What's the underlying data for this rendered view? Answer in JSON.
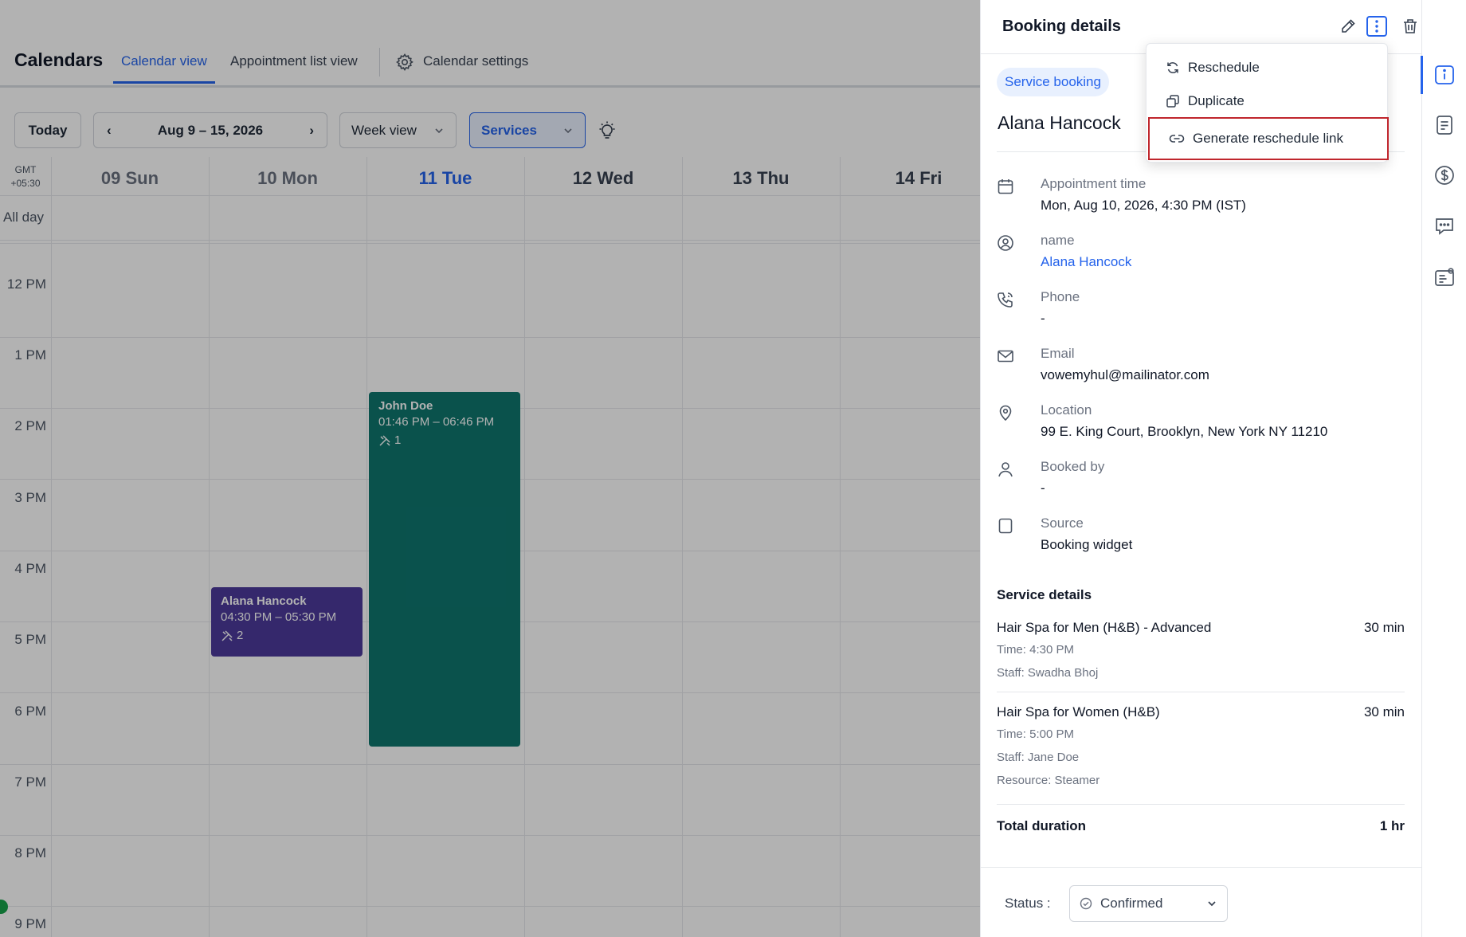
{
  "app": {
    "title": "Calendars"
  },
  "tabs": [
    {
      "label": "Calendar view"
    },
    {
      "label": "Appointment list view"
    },
    {
      "label": "Calendar settings"
    }
  ],
  "toolbar": {
    "today_label": "Today",
    "date_range": "Aug 9 – 15, 2026",
    "view_select": "Week view",
    "filter_select": "Services"
  },
  "calendar": {
    "timezone_line1": "GMT",
    "timezone_line2": "+05:30",
    "days": [
      "09 Sun",
      "10 Mon",
      "11 Tue",
      "12 Wed",
      "13 Thu",
      "14 Fri"
    ],
    "allday_label": "All day",
    "hours": [
      "12 PM",
      "1 PM",
      "2 PM",
      "3 PM",
      "4 PM",
      "5 PM",
      "6 PM",
      "7 PM",
      "8 PM",
      "9 PM"
    ],
    "events": {
      "john": {
        "name": "John Doe",
        "time": "01:46 PM – 06:46 PM",
        "count": "1"
      },
      "alana": {
        "name": "Alana Hancock",
        "time": "04:30 PM – 05:30 PM",
        "count": "2"
      }
    },
    "colors": {
      "event_teal": "#0f766e",
      "event_purple": "#4c3a9b",
      "accent": "#2563eb"
    }
  },
  "panel": {
    "title": "Booking details",
    "badge": "Service booking",
    "customer_name": "Alana Hancock",
    "fields": {
      "appointment": {
        "label": "Appointment time",
        "value": "Mon, Aug 10, 2026, 4:30 PM (IST)"
      },
      "name": {
        "label": "name",
        "value": "Alana Hancock"
      },
      "phone": {
        "label": "Phone",
        "value": "-"
      },
      "email": {
        "label": "Email",
        "value": "vowemyhul@mailinator.com"
      },
      "location": {
        "label": "Location",
        "value": "99 E. King Court, Brooklyn, New York NY 11210"
      },
      "booked_by": {
        "label": "Booked by",
        "value": "-"
      },
      "source": {
        "label": "Source",
        "value": "Booking widget"
      }
    },
    "service_details_title": "Service details",
    "services": [
      {
        "name": "Hair Spa for Men (H&B) - Advanced",
        "duration": "30 min",
        "time": "Time: 4:30 PM",
        "staff": "Staff: Swadha Bhoj"
      },
      {
        "name": "Hair Spa for Women (H&B)",
        "duration": "30 min",
        "time": "Time: 5:00 PM",
        "staff": "Staff: Jane Doe",
        "resource": "Resource: Steamer"
      }
    ],
    "total_label": "Total duration",
    "total_value": "1 hr",
    "status_label": "Status :",
    "status_value": "Confirmed"
  },
  "menu": {
    "items": [
      {
        "label": "Reschedule",
        "icon": "refresh-icon"
      },
      {
        "label": "Duplicate",
        "icon": "copy-icon"
      },
      {
        "label": "Generate reschedule link",
        "icon": "link-icon"
      }
    ]
  },
  "rail": {
    "icons": [
      "info-icon",
      "notes-icon",
      "dollar-icon",
      "chat-icon",
      "contact-card-icon"
    ]
  }
}
